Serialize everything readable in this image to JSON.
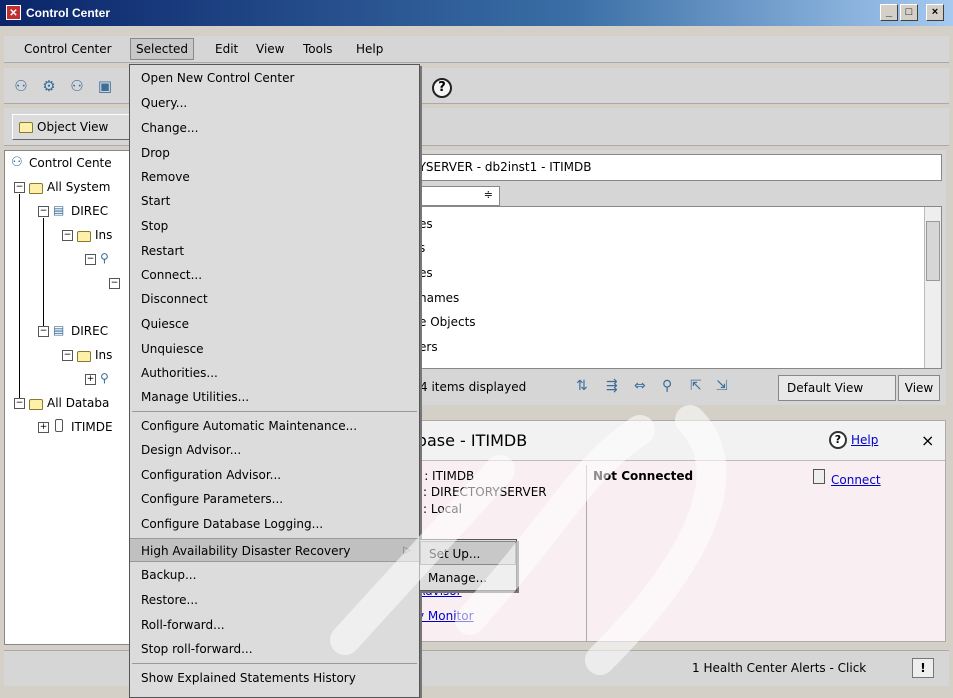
{
  "window": {
    "title": "Control Center",
    "min_glyph": "_",
    "max_glyph": "□",
    "close_glyph": "×"
  },
  "menubar": {
    "items": [
      "Control Center",
      "Selected",
      "Edit",
      "View",
      "Tools",
      "Help"
    ]
  },
  "objbar": {
    "object_view_label": "Object View"
  },
  "tree": {
    "items": [
      "Control Cente",
      "All System",
      "DIREC",
      "Ins",
      "DIREC",
      "Ins",
      "All Databa",
      "ITIMDE"
    ]
  },
  "right": {
    "breadcrumb": "RYSERVER - db2inst1 - ITIMDB",
    "view_select_arrow": "≑",
    "list_rows": [
      "es",
      "s",
      "es",
      "names",
      "e Objects",
      "ers"
    ],
    "items_displayed": "4 items displayed",
    "default_view": "Default View",
    "view_button": "View"
  },
  "details": {
    "title": "abase - ITIMDB",
    "help_link": "Help",
    "close_glyph": "×",
    "name_line": "e : ITIMDB",
    "server_line": ": DIRECTORYSERVER",
    "location_line": ": Local",
    "status": "Not Connected",
    "connect_link": "Connect",
    "link_advisor": "Advisor",
    "link_monitor": "y Monitor"
  },
  "statusbar": {
    "alerts_text": "1 Health Center Alerts - Click"
  },
  "dropdown": {
    "items": [
      "Open New Control Center",
      "Query...",
      "Change...",
      "Drop",
      "Remove",
      "Start",
      "Stop",
      "Restart",
      "Connect...",
      "Disconnect",
      "Quiesce",
      "Unquiesce",
      "Authorities...",
      "Manage Utilities...",
      "Configure Automatic Maintenance...",
      "Design Advisor...",
      "Configuration Advisor...",
      "Configure Parameters...",
      "Configure Database Logging...",
      "High Availability Disaster Recovery",
      "Backup...",
      "Restore...",
      "Roll-forward...",
      "Stop roll-forward...",
      "Show Explained Statements History"
    ],
    "submenu_arrow": "▷"
  },
  "submenu": {
    "items": [
      "Set Up...",
      "Manage..."
    ]
  },
  "colors": {
    "titlebar": "#0a246a",
    "details_bg": "#f9eef2",
    "link": "#0000cc"
  }
}
